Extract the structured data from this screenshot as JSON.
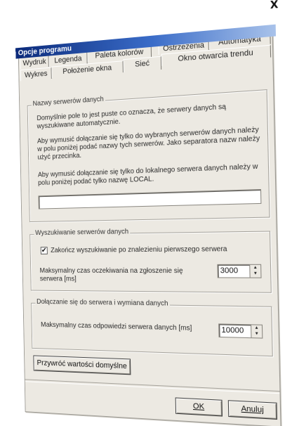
{
  "window": {
    "title": "Opcje programu",
    "close_glyph": "X"
  },
  "tabs": {
    "row_back": [
      "Wydruk",
      "Legenda",
      "Paleta kolorów",
      "Ostrzeżenia",
      "Automatyka"
    ],
    "row_front": [
      "Wykres",
      "Położenie okna",
      "Sieć",
      "Okno otwarcia trendu"
    ],
    "active": "Sieć"
  },
  "group_servers": {
    "legend": "Nazwy serwerów danych",
    "para1": "Domyślnie pole to jest puste co oznacza, że serwery danych są wyszukiwane automatycznie.",
    "para2": "Aby wymusić dołączanie się tylko do wybranych serwerów danych należy w polu poniżej podać nazwy tych serwerów. Jako separatora nazw należy użyć przecinka.",
    "para3": "Aby wymusić dołączanie się tylko do lokalnego serwera danych należy w polu poniżej podać tylko nazwę LOCAL.",
    "names_value": ""
  },
  "group_search": {
    "legend": "Wyszukiwanie serwerów danych",
    "checkbox_label": "Zakończ wyszukiwanie po znalezieniu pierwszego serwera",
    "checkbox_checked": true,
    "checkbox_mark": "✔",
    "timeout_label": "Maksymalny czas oczekiwania na zgłoszenie się serwera [ms]",
    "timeout_value": "3000"
  },
  "group_connect": {
    "legend": "Dołączanie się do serwera i wymiana danych",
    "response_label": "Maksymalny czas odpowiedzi serwera danych [ms]",
    "response_value": "10000"
  },
  "buttons": {
    "restore_defaults": "Przywróć wartości domyślne",
    "ok": "OK",
    "cancel": "Anuluj"
  },
  "icons": {
    "spin_up": "up-arrow-icon",
    "spin_down": "down-arrow-icon",
    "close": "close-icon"
  },
  "colors": {
    "title_gradient_start": "#0b2a7a",
    "title_gradient_end": "#a8c2ea",
    "dialog_face": "#ece9e2"
  }
}
